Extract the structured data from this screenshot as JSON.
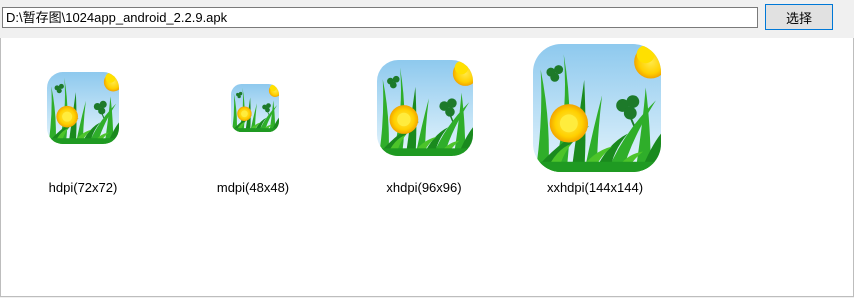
{
  "toolbar": {
    "path_value": "D:\\暂存图\\1024app_android_2.2.9.apk",
    "choose_label": "选择"
  },
  "icons": [
    {
      "label": "hdpi(72x72)",
      "icon": "meadow-flower-icon"
    },
    {
      "label": "mdpi(48x48)",
      "icon": "meadow-flower-icon"
    },
    {
      "label": "xhdpi(96x96)",
      "icon": "meadow-flower-icon"
    },
    {
      "label": "xxhdpi(144x144)",
      "icon": "meadow-flower-icon"
    }
  ],
  "colors": {
    "sky_top": "#8ec9ee",
    "sky_bottom": "#dff1fb",
    "grass_dark": "#1f8d1f",
    "grass_light": "#4cc42a",
    "flower_yellow": "#ffd400",
    "flower_orange": "#f5a300",
    "button_border": "#0078d7"
  }
}
